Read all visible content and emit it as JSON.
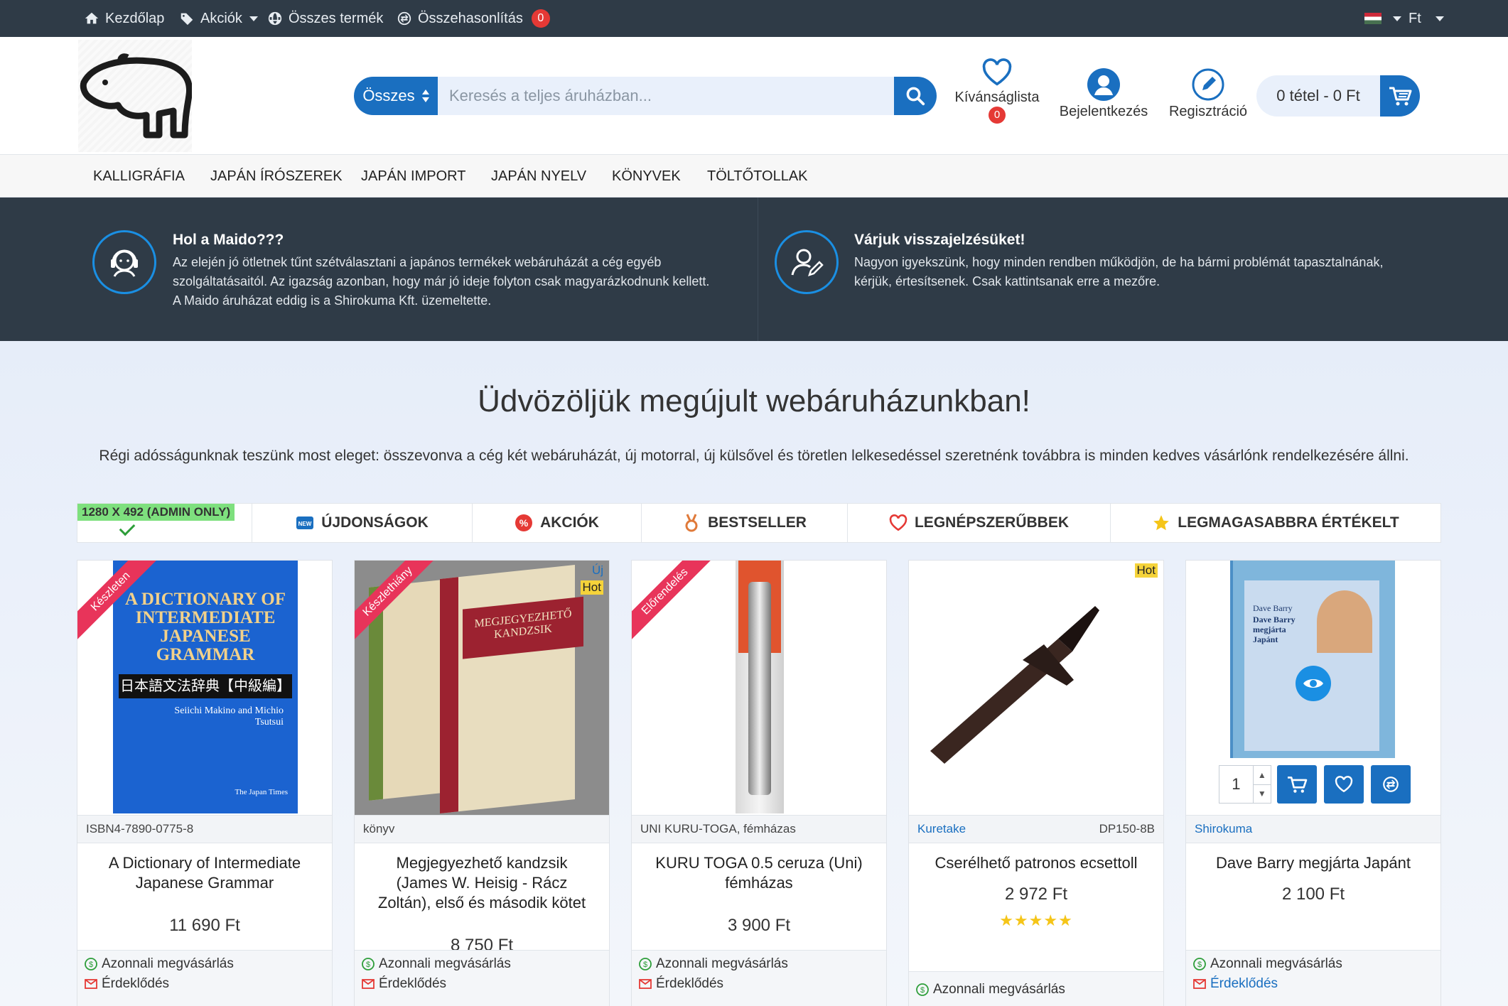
{
  "topbar": {
    "home": "Kezdőlap",
    "deals": "Akciók",
    "all_products": "Összes termék",
    "compare": "Összehasonlítás",
    "compare_count": "0",
    "currency": "Ft"
  },
  "header": {
    "search_category": "Összes",
    "search_placeholder": "Keresés a teljes áruházban...",
    "wishlist": "Kívánságlista",
    "wishlist_count": "0",
    "login": "Bejelentkezés",
    "register": "Regisztráció",
    "cart": "0 tétel - 0 Ft"
  },
  "nav": [
    "Kalligráfia",
    "Japán írószerek",
    "Japán import",
    "Japán nyelv",
    "Könyvek",
    "Töltőtollak"
  ],
  "info": {
    "left_title": "Hol a Maido???",
    "left_text_1": "Az elején jó ötletnek tűnt szétválasztani a japános termékek webáruházát a cég egyéb",
    "left_text_2": "szolgáltatásaitól. Az igazság azonban, hogy már jó ideje folyton csak magyarázkodnunk kellett.",
    "left_text_3": "A Maido áruházat eddig is a Shirokuma Kft. üzemeltette.",
    "right_title": "Várjuk visszajelzésüket!",
    "right_text_1": "Nagyon igyekszünk, hogy minden rendben működjön, de ha bármi problémát tapasztalnának,",
    "right_text_2": "kérjük, értesítsenek. Csak kattintsanak erre a mezőre."
  },
  "main": {
    "title": "Üdvözöljük megújult webáruházunkban!",
    "subtitle": "Régi adósságunknak teszünk most eleget: összevonva a cég két webáruházát, új motorral, új külsővel és töretlen lelkesedéssel szeretnénk továbbra is minden kedves vásárlónk rendelkezésére állni.",
    "admin_badge": "1280 x 492 (Admin Only)",
    "tabs": [
      "Újdonságok",
      "Akciók",
      "Bestseller",
      "Legnépszerűbbek",
      "Legmagasabbra értékelt"
    ]
  },
  "products": [
    {
      "ribbon": "Készleten",
      "meta_left": "ISBN4-7890-0775-8",
      "meta_right": "",
      "name": "A Dictionary of Intermediate Japanese Grammar",
      "price": "11 690 Ft",
      "buy": "Azonnali megvásárlás",
      "ask": "Érdeklődés",
      "cover_title": "A DICTIONARY OF INTERMEDIATE JAPANESE GRAMMAR",
      "cover_jp": "日本語文法辞典【中級編】",
      "cover_authors": "Seiichi Makino and Michio Tsutsui",
      "cover_pub": "The Japan Times"
    },
    {
      "ribbon": "Készlethiány",
      "meta_left": "könyv",
      "meta_right": "",
      "name": "Megjegyezhető kandzsik (James W. Heisig - Rácz Zoltán), első és második kötet",
      "price": "8 750 Ft",
      "buy": "Azonnali megvásárlás",
      "ask": "Érdeklődés",
      "tag_new": "Új",
      "tag_hot": "Hot",
      "cover_title": "MEGJEGYEZHETŐ KANDZSIK"
    },
    {
      "ribbon": "Előrendelés",
      "meta_left": "UNI KURU-TOGA, fémházas",
      "meta_right": "",
      "name": "KURU TOGA 0.5 ceruza (Uni) fémházas",
      "price": "3 900 Ft",
      "buy": "Azonnali megvásárlás",
      "ask": "Érdeklődés"
    },
    {
      "meta_left": "Kuretake",
      "meta_right": "DP150-8B",
      "name": "Cserélhető patronos ecsettoll",
      "price": "2 972 Ft",
      "rating": 5,
      "tag_hot": "Hot",
      "buy": "Azonnali megvásárlás"
    },
    {
      "meta_left": "Shirokuma",
      "meta_right": "",
      "name": "Dave Barry megjárta Japánt",
      "price": "2 100 Ft",
      "buy": "Azonnali megvásárlás",
      "ask": "Érdeklődés",
      "qty": "1",
      "cover_author": "Dave Barry",
      "cover_title": "Dave Barry megjárta Japánt"
    }
  ],
  "colors": {
    "accent": "#1a6fc0",
    "dark": "#2f3b47",
    "ribbon": "#e8345a",
    "hot": "#f5d33a",
    "success": "#2e9e3a"
  }
}
